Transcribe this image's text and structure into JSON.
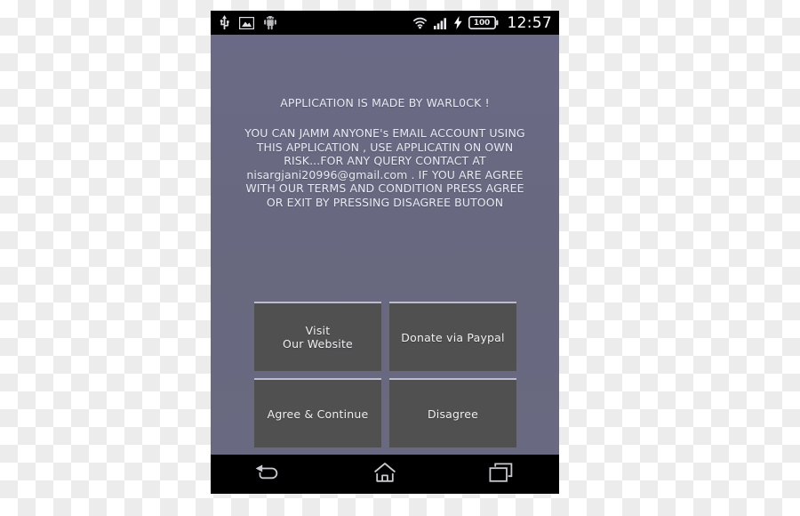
{
  "status_bar": {
    "left_icons": [
      {
        "name": "usb-icon",
        "label": "USB"
      },
      {
        "name": "screenshot-icon",
        "label": "Screenshot"
      },
      {
        "name": "android-robot-icon",
        "label": "Android"
      }
    ],
    "right_icons": [
      {
        "name": "wifi-icon",
        "label": "Wi-Fi"
      },
      {
        "name": "signal-bars-icon",
        "label": "Signal"
      },
      {
        "name": "charging-bolt-icon",
        "label": "Charging"
      }
    ],
    "battery_level": "100",
    "clock": "12:57"
  },
  "screen": {
    "headline": "APPLICATION IS MADE BY WARL0CK !",
    "paragraph_lines": [
      "YOU CAN JAMM ANYONE's EMAIL ACCOUNT USING",
      "THIS APPLICATION , USE APPLICATIN ON OWN",
      "RISK...FOR ANY QUERY CONTACT AT",
      "nisargjani20996@gmail.com . IF YOU ARE AGREE",
      "WITH OUR TERMS AND CONDITION PRESS AGREE",
      "OR EXIT BY PRESSING DISAGREE BUTOON"
    ],
    "buttons": [
      {
        "name": "visit-our-website-button",
        "line1": "Visit",
        "line2": "Our Website"
      },
      {
        "name": "donate-via-paypal-button",
        "line1": "Donate via Paypal",
        "line2": ""
      },
      {
        "name": "agree-and-continue-button",
        "line1": "Agree & Continue",
        "line2": ""
      },
      {
        "name": "disagree-button",
        "line1": "Disagree",
        "line2": ""
      }
    ]
  },
  "nav_bar": {
    "items": [
      {
        "name": "nav-back-icon",
        "label": "Back"
      },
      {
        "name": "nav-home-icon",
        "label": "Home"
      },
      {
        "name": "nav-recents-icon",
        "label": "Recents"
      }
    ]
  },
  "colors": {
    "screen_background": "#68687f",
    "button_fill": "#505050",
    "button_top_border": "#bdbdc9",
    "text": "#e9e9f2",
    "system_bar": "#000000"
  }
}
